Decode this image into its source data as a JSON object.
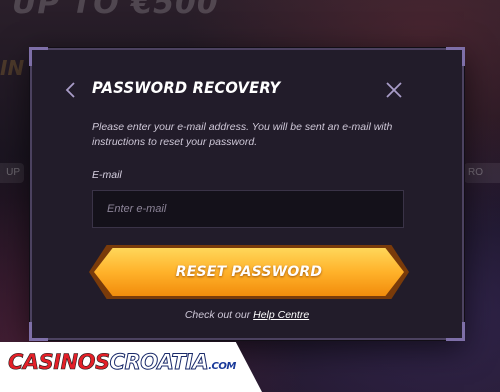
{
  "background": {
    "promo_text": "UP TO €500",
    "promo_text_2": "IN",
    "left_pill": "UP",
    "right_pill": "RO"
  },
  "modal": {
    "title": "PASSWORD RECOVERY",
    "description": "Please enter your e-mail address. You will be sent an e-mail with instructions to reset your password.",
    "email_label": "E-mail",
    "email_placeholder": "Enter e-mail",
    "email_value": "",
    "reset_button_label": "RESET PASSWORD",
    "help_prefix": "Check out our",
    "help_link_label": "Help Centre",
    "back_icon": "chevron-left-icon",
    "close_icon": "close-icon"
  },
  "watermark": {
    "part1": "CASINOS",
    "part2": "CROATIA",
    "part3": ".COM"
  },
  "colors": {
    "accent_orange": "#ffb22a",
    "modal_bg": "#221c2a",
    "modal_border": "#4c4260",
    "logo_red": "#e32028",
    "logo_blue": "#1a3a9a"
  }
}
